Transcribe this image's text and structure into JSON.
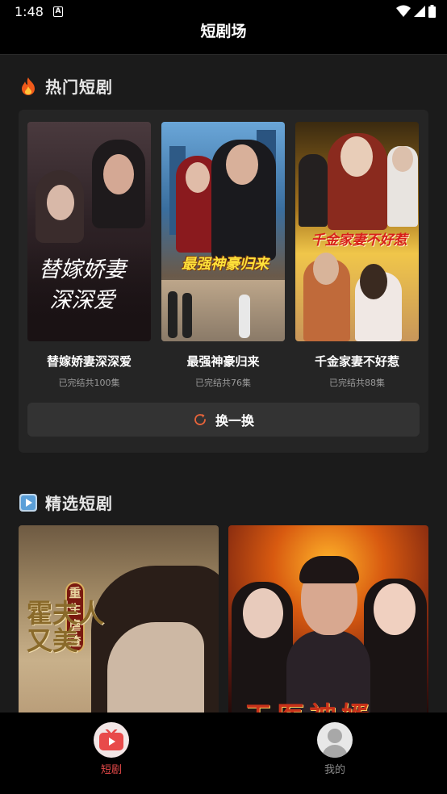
{
  "status": {
    "time": "1:48",
    "notif": "A"
  },
  "app": {
    "title": "短剧场"
  },
  "hot": {
    "title": "热门短剧",
    "items": [
      {
        "title": "替嫁娇妻深深爱",
        "subtitle": "已完结共100集",
        "poster_text": "替嫁娇妻深深爱"
      },
      {
        "title": "最强神豪归来",
        "subtitle": "已完结共76集",
        "poster_text": "最强神豪归来"
      },
      {
        "title": "千金家妻不好惹",
        "subtitle": "已完结共88集",
        "poster_text": "千金家妻不好惹"
      }
    ],
    "swap_label": "换一换"
  },
  "featured": {
    "title": "精选短剧",
    "items": [
      {
        "poster_text": "霍夫人又美",
        "badge": "重生虐渣"
      },
      {
        "poster_text": "天医神婿"
      }
    ]
  },
  "tabs": [
    {
      "label": "短剧",
      "active": true
    },
    {
      "label": "我的",
      "active": false
    }
  ],
  "colors": {
    "accent": "#e84a4a",
    "swap_icon": "#e8643a"
  }
}
